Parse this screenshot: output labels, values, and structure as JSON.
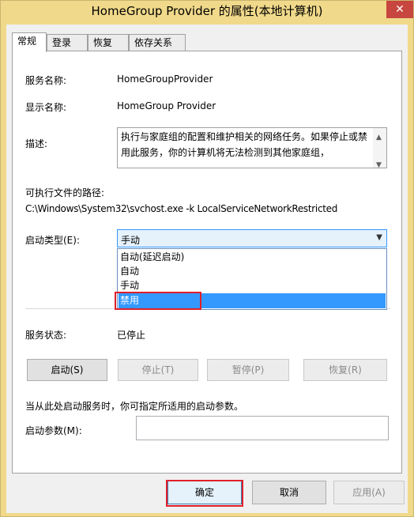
{
  "window": {
    "title": "HomeGroup Provider 的属性(本地计算机)",
    "close_glyph": "✕"
  },
  "tabs": [
    {
      "label": "常规",
      "active": true
    },
    {
      "label": "登录",
      "active": false
    },
    {
      "label": "恢复",
      "active": false
    },
    {
      "label": "依存关系",
      "active": false
    }
  ],
  "general": {
    "service_name_label": "服务名称:",
    "service_name_value": "HomeGroupProvider",
    "display_name_label": "显示名称:",
    "display_name_value": "HomeGroup Provider",
    "description_label": "描述:",
    "description_value": "执行与家庭组的配置和维护相关的网络任务。如果停止或禁用此服务，你的计算机将无法检测到其他家庭组，",
    "path_label": "可执行文件的路径:",
    "path_value": "C:\\Windows\\System32\\svchost.exe -k LocalServiceNetworkRestricted",
    "startup_type_label": "启动类型(E):",
    "startup_type_value": "手动",
    "startup_options": [
      "自动(延迟启动)",
      "自动",
      "手动",
      "禁用"
    ],
    "highlighted_option": "禁用",
    "service_status_label": "服务状态:",
    "service_status_value": "已停止",
    "start_button": "启动(S)",
    "stop_button": "停止(T)",
    "pause_button": "暂停(P)",
    "resume_button": "恢复(R)",
    "hint_text": "当从此处启动服务时，你可指定所适用的启动参数。",
    "start_params_label": "启动参数(M):",
    "start_params_value": ""
  },
  "footer": {
    "ok_button": "确定",
    "cancel_button": "取消",
    "apply_button": "应用(A)"
  },
  "colors": {
    "highlight": "#3399ff",
    "annotation_red": "#e0202a",
    "title_bar": "#f0d98a"
  }
}
